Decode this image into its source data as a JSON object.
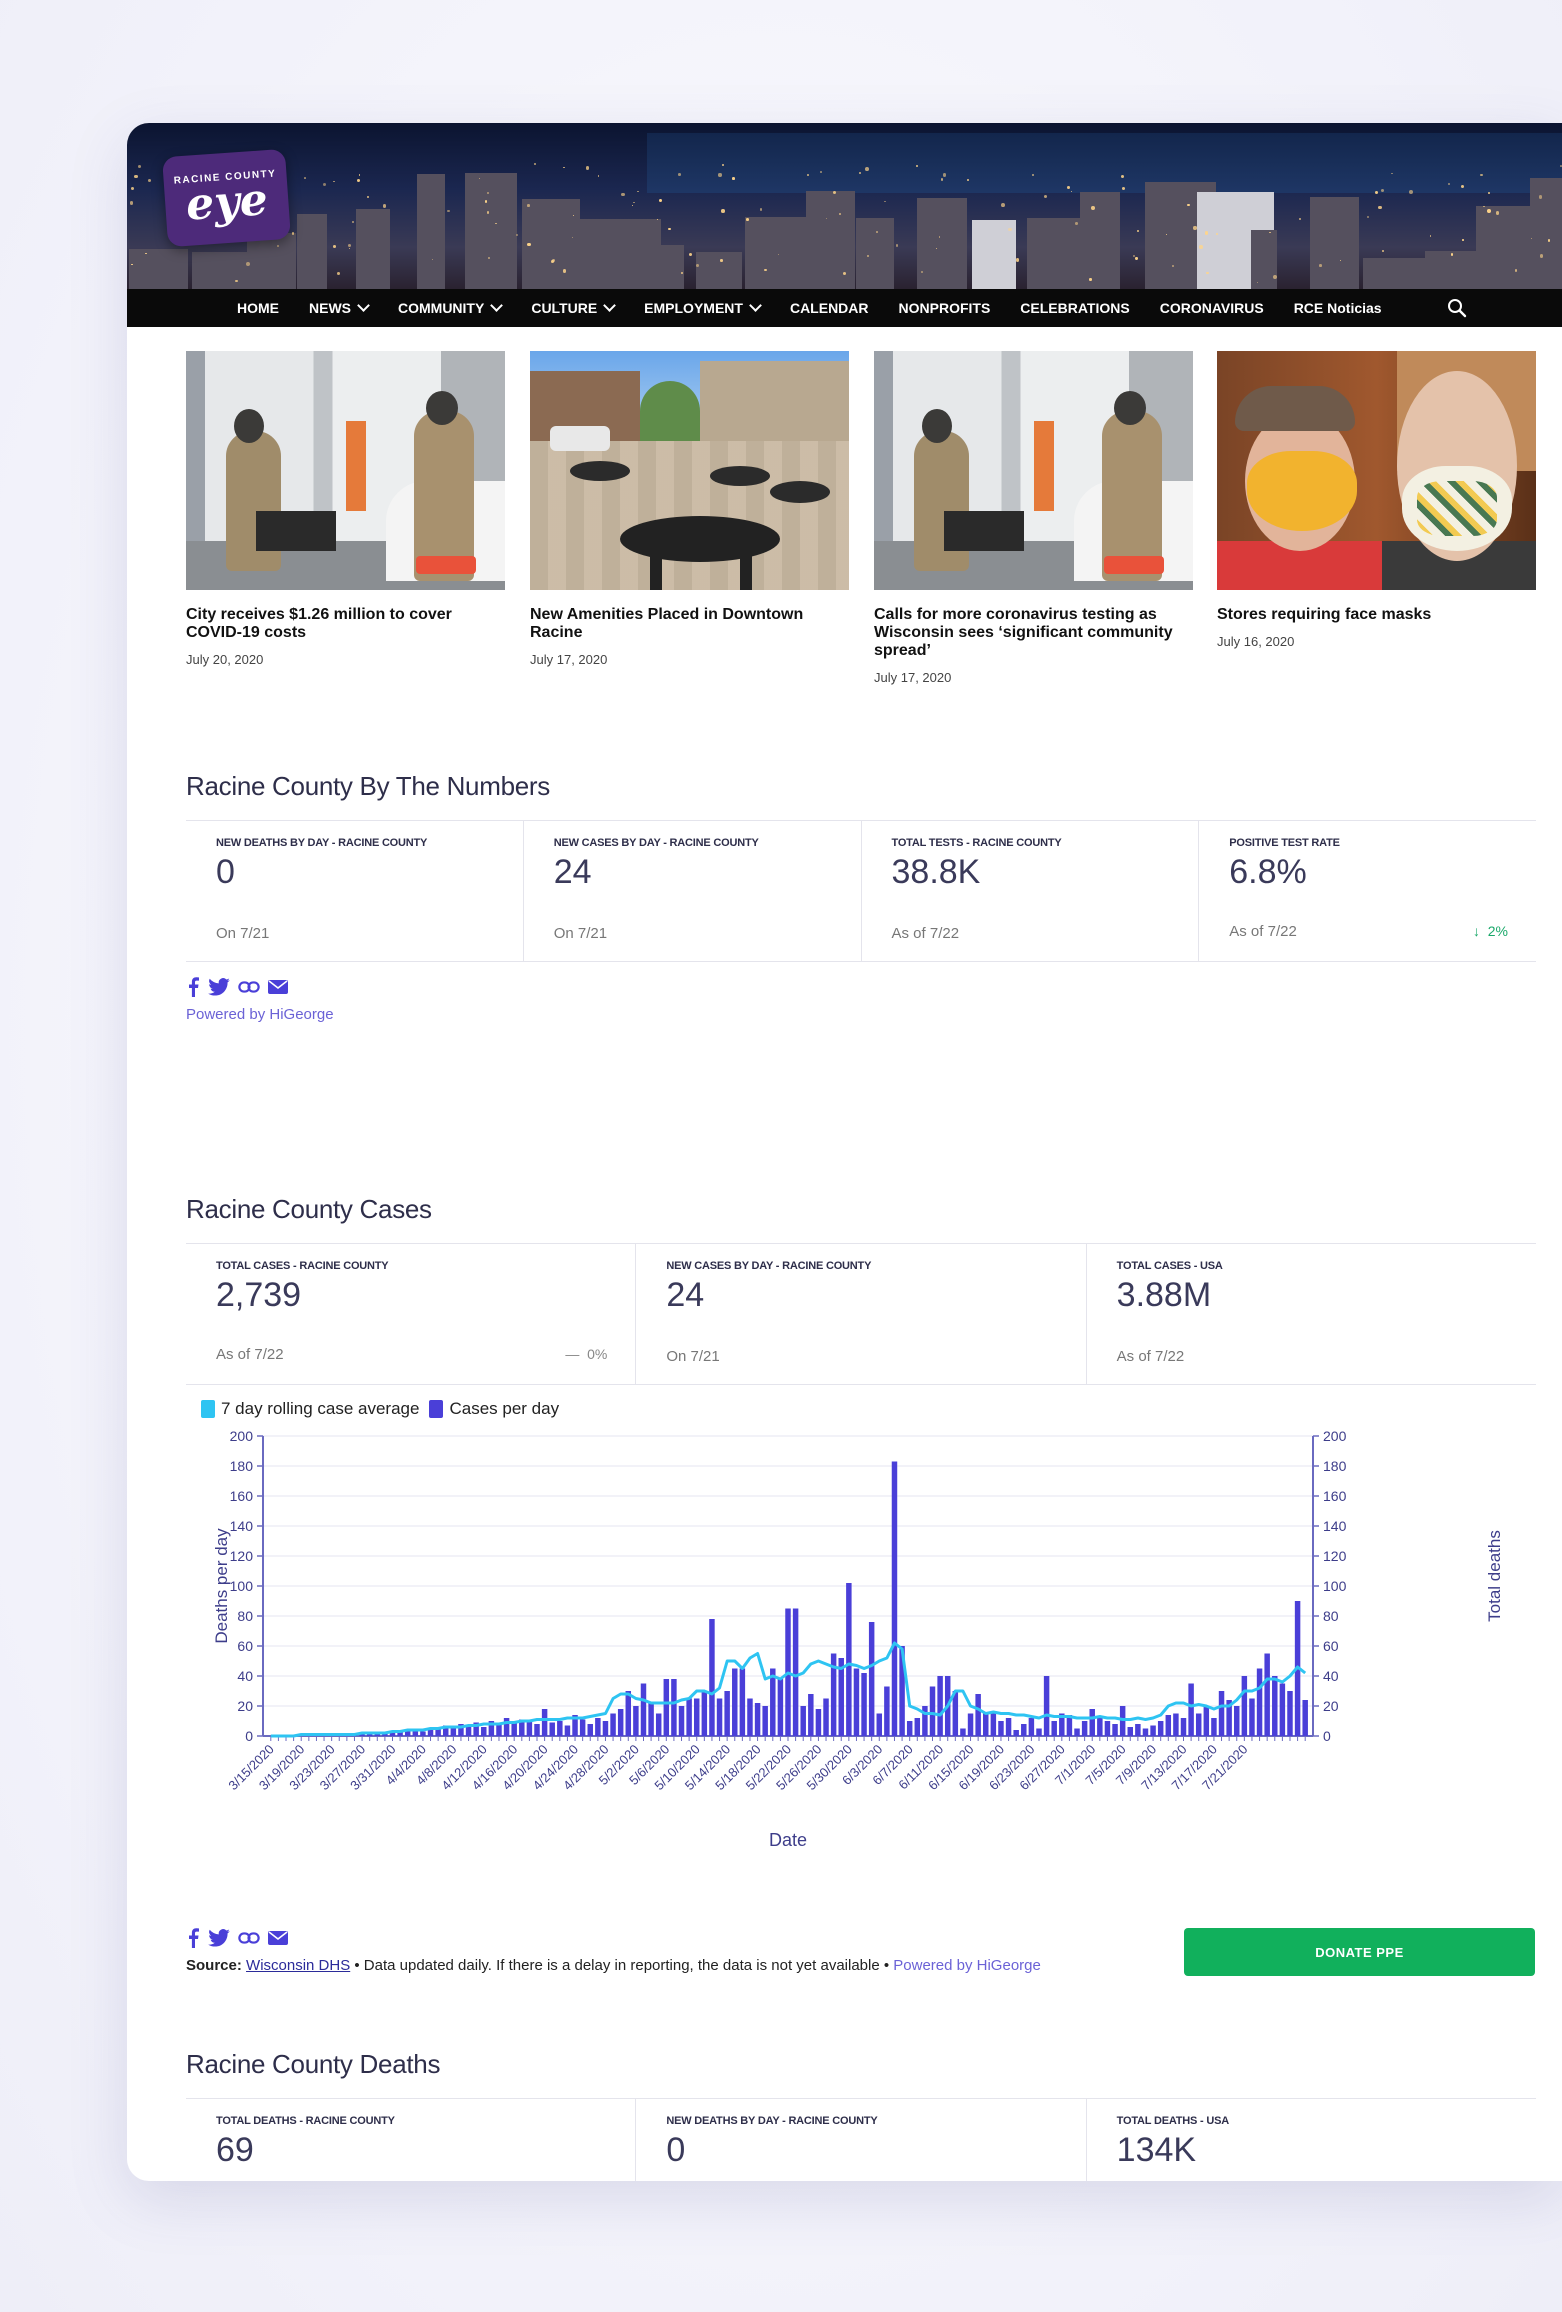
{
  "site": {
    "logo_small": "RACINE COUNTY",
    "logo_big": "eye"
  },
  "nav": {
    "items": [
      {
        "label": "HOME",
        "dropdown": false
      },
      {
        "label": "NEWS",
        "dropdown": true
      },
      {
        "label": "COMMUNITY",
        "dropdown": true
      },
      {
        "label": "CULTURE",
        "dropdown": true
      },
      {
        "label": "EMPLOYMENT",
        "dropdown": true
      },
      {
        "label": "CALENDAR",
        "dropdown": false
      },
      {
        "label": "NONPROFITS",
        "dropdown": false
      },
      {
        "label": "CELEBRATIONS",
        "dropdown": false
      },
      {
        "label": "CORONAVIRUS",
        "dropdown": false
      },
      {
        "label": "RCE Noticias",
        "dropdown": false
      }
    ],
    "search_icon": "search-icon"
  },
  "articles": [
    {
      "title": "City receives $1.26 million to cover COVID-19 costs",
      "date": "July 20, 2020"
    },
    {
      "title": "New Amenities Placed in Downtown Racine",
      "date": "July 17, 2020"
    },
    {
      "title": "Calls for more coronavirus testing as Wisconsin sees ‘significant community spread’",
      "date": "July 17, 2020"
    },
    {
      "title": "Stores requiring face masks",
      "date": "July 16, 2020"
    }
  ],
  "numbers": {
    "title": "Racine County By The Numbers",
    "stats": [
      {
        "label": "NEW DEATHS BY DAY - RACINE COUNTY",
        "value": "0",
        "sub": "On 7/21"
      },
      {
        "label": "NEW CASES BY DAY - RACINE COUNTY",
        "value": "24",
        "sub": "On 7/21"
      },
      {
        "label": "TOTAL TESTS - RACINE COUNTY",
        "value": "38.8K",
        "sub": "As of 7/22"
      },
      {
        "label": "POSITIVE TEST RATE",
        "value": "6.8%",
        "sub": "As of 7/22",
        "delta": "2%",
        "delta_color": "#1aa86a"
      }
    ],
    "powered": "Powered by HiGeorge"
  },
  "cases": {
    "title": "Racine County Cases",
    "stats": [
      {
        "label": "TOTAL CASES - RACINE COUNTY",
        "value": "2,739",
        "sub": "As of 7/22",
        "delta": "0%",
        "delta_color": "#888"
      },
      {
        "label": "NEW CASES BY DAY - RACINE COUNTY",
        "value": "24",
        "sub": "On 7/21"
      },
      {
        "label": "TOTAL CASES - USA",
        "value": "3.88M",
        "sub": "As of 7/22"
      }
    ],
    "legend": {
      "line": "7 day rolling case average",
      "bar": "Cases per day",
      "line_color": "#2ec4f2",
      "bar_color": "#4a3fd8"
    }
  },
  "source": {
    "label": "Source:",
    "link": "Wisconsin DHS",
    "text": " • Data updated daily. If there is a delay in reporting, the data is not yet available • ",
    "powered": "Powered by HiGeorge"
  },
  "donate": {
    "label": "DONATE PPE",
    "color": "#11b05c"
  },
  "deaths": {
    "title": "Racine County Deaths",
    "stats": [
      {
        "label": "TOTAL DEATHS - RACINE COUNTY",
        "value": "69"
      },
      {
        "label": "NEW DEATHS BY DAY - RACINE COUNTY",
        "value": "0"
      },
      {
        "label": "TOTAL DEATHS - USA",
        "value": "134K"
      }
    ]
  },
  "chart_data": {
    "type": "bar",
    "xlabel": "Date",
    "ylabel": "Deaths per day",
    "y2label": "Total deaths",
    "ylim": [
      0,
      200
    ],
    "y2lim": [
      0,
      200
    ],
    "yticks": [
      0,
      20,
      40,
      60,
      80,
      100,
      120,
      140,
      160,
      180,
      200
    ],
    "grid": true,
    "legend_position": "top-left",
    "start_date": "3/15/2020",
    "tick_labels": [
      "3/15/2020",
      "3/19/2020",
      "3/23/2020",
      "3/27/2020",
      "3/31/2020",
      "4/4/2020",
      "4/8/2020",
      "4/12/2020",
      "4/16/2020",
      "4/20/2020",
      "4/24/2020",
      "4/28/2020",
      "5/2/2020",
      "5/6/2020",
      "5/10/2020",
      "5/14/2020",
      "5/18/2020",
      "5/22/2020",
      "5/26/2020",
      "5/30/2020",
      "6/3/2020",
      "6/7/2020",
      "6/11/2020",
      "6/15/2020",
      "6/19/2020",
      "6/23/2020",
      "6/27/2020",
      "7/1/2020",
      "7/5/2020",
      "7/9/2020",
      "7/13/2020",
      "7/17/2020",
      "7/21/2020"
    ],
    "series": [
      {
        "name": "Cases per day",
        "type": "bar",
        "values": [
          0,
          0,
          1,
          0,
          1,
          1,
          1,
          0,
          1,
          2,
          1,
          2,
          1,
          2,
          3,
          2,
          3,
          4,
          4,
          5,
          3,
          5,
          6,
          7,
          6,
          8,
          7,
          9,
          6,
          10,
          8,
          12,
          9,
          11,
          10,
          8,
          18,
          9,
          10,
          7,
          14,
          11,
          8,
          12,
          10,
          15,
          18,
          30,
          20,
          35,
          22,
          15,
          38,
          38,
          20,
          25,
          25,
          30,
          78,
          25,
          30,
          45,
          45,
          25,
          22,
          20,
          45,
          38,
          85,
          85,
          20,
          28,
          18,
          25,
          55,
          52,
          102,
          45,
          42,
          76,
          15,
          33,
          183,
          60,
          10,
          12,
          20,
          33,
          40,
          40,
          30,
          5,
          15,
          28,
          15,
          15,
          10,
          12,
          4,
          8,
          12,
          5,
          40,
          10,
          15,
          14,
          5,
          10,
          18,
          12,
          10,
          8,
          20,
          6,
          8,
          5,
          7,
          10,
          14,
          15,
          12,
          35,
          15,
          20,
          12,
          30,
          24,
          20,
          40,
          25,
          45,
          55,
          40,
          35,
          30,
          90,
          24
        ],
        "color": "#4a3fd8"
      },
      {
        "name": "7 day rolling case average",
        "type": "line",
        "values": [
          0,
          0,
          0,
          0,
          1,
          1,
          1,
          1,
          1,
          1,
          1,
          1,
          2,
          2,
          2,
          2,
          3,
          3,
          4,
          4,
          4,
          5,
          5,
          6,
          6,
          6,
          7,
          7,
          8,
          8,
          8,
          9,
          9,
          10,
          10,
          11,
          11,
          11,
          11,
          12,
          12,
          12,
          13,
          14,
          15,
          25,
          28,
          28,
          25,
          24,
          22,
          22,
          22,
          22,
          24,
          25,
          30,
          30,
          28,
          32,
          50,
          50,
          45,
          52,
          55,
          38,
          40,
          38,
          42,
          40,
          42,
          48,
          50,
          48,
          46,
          45,
          48,
          47,
          45,
          47,
          50,
          52,
          62,
          58,
          20,
          18,
          15,
          15,
          14,
          20,
          30,
          30,
          20,
          18,
          15,
          16,
          15,
          15,
          14,
          14,
          13,
          12,
          14,
          13,
          13,
          13,
          12,
          12,
          12,
          13,
          12,
          12,
          11,
          11,
          12,
          11,
          12,
          14,
          20,
          22,
          22,
          20,
          21,
          20,
          18,
          20,
          20,
          24,
          30,
          30,
          32,
          38,
          38,
          36,
          40,
          46,
          42
        ],
        "color": "#2ec4f2"
      }
    ]
  }
}
